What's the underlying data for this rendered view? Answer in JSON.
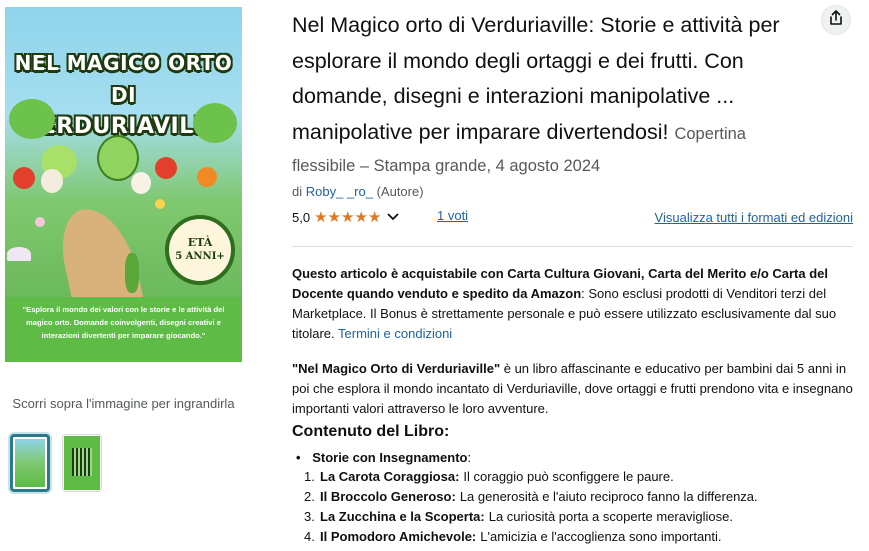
{
  "cover": {
    "title_lines": [
      "NEL MAGICO ORTO",
      "DI",
      "VERDURIAVILLE"
    ],
    "badge_line1": "ETÀ",
    "badge_line2": "5 ANNI+",
    "blurb": "\"Esplora il mondo dei valori con le storie e le attività del magico orto. Domande coinvolgenti, disegni creativi e interazioni divertenti per imparare giocando.\""
  },
  "gallery": {
    "hover_hint": "Scorri sopra l'immagine per ingrandirla"
  },
  "product": {
    "title": "Nel Magico orto di Verduriaville: Storie e attività per esplorare il mondo degli ortaggi e dei frutti. Con domande, disegni e interazioni manipolative ... manipolative per imparare divertendosi!",
    "binding_word": "Copertina",
    "binding_rest": "flessibile – Stampa grande, 4 agosto 2024",
    "byline_prefix": "di",
    "author": "Roby_ _ro_",
    "author_role": "(Autore)",
    "rating_value": "5,0",
    "rating_stars": 5,
    "votes": "1 voti",
    "formats_link": "Visualizza tutti i formati ed edizioni"
  },
  "promo": {
    "bold_text": "Questo articolo è acquistabile con Carta Cultura Giovani, Carta del Merito e/o Carta del Docente quando venduto e spedito da Amazon",
    "rest_text": ": Sono esclusi prodotti di Venditori terzi del Marketplace. Il Bonus è strettamente personale e può essere utilizzato esclusivamente dal suo titolare.",
    "link": "Termini e condizioni"
  },
  "description": {
    "intro_bold": "\"Nel Magico Orto di Verduriaville\"",
    "intro_rest": " è un libro affascinante e educativo per bambini dai 5 anni in poi che esplora il mondo incantato di Verduriaville, dove ortaggi e frutti prendono vita e insegnano importanti valori attraverso le loro avventure.",
    "section_title": "Contenuto del Libro:",
    "bullet": "Storie con Insegnamento",
    "bullet_colon": ":",
    "stories": [
      {
        "num": "1.",
        "title": "La Carota Coraggiosa:",
        "text": "Il coraggio può sconfiggere le paure."
      },
      {
        "num": "2.",
        "title": "Il Broccolo Generoso:",
        "text": "La generosità e l'aiuto reciproco fanno la differenza."
      },
      {
        "num": "3.",
        "title": "La Zucchina e la Scoperta:",
        "text": "La curiosità porta a scoperte meravigliose."
      },
      {
        "num": "4.",
        "title": "Il Pomodoro Amichevole:",
        "text": "L'amicizia e l'accoglienza sono importanti."
      }
    ]
  },
  "icons": {
    "share": "share-icon",
    "chevron": "chevron-down-icon",
    "star": "star-icon"
  },
  "colors": {
    "link": "#2162a1",
    "star": "#de7921",
    "text": "#0f1111",
    "muted": "#565959",
    "thumb_selected": "#2b7a8c"
  }
}
